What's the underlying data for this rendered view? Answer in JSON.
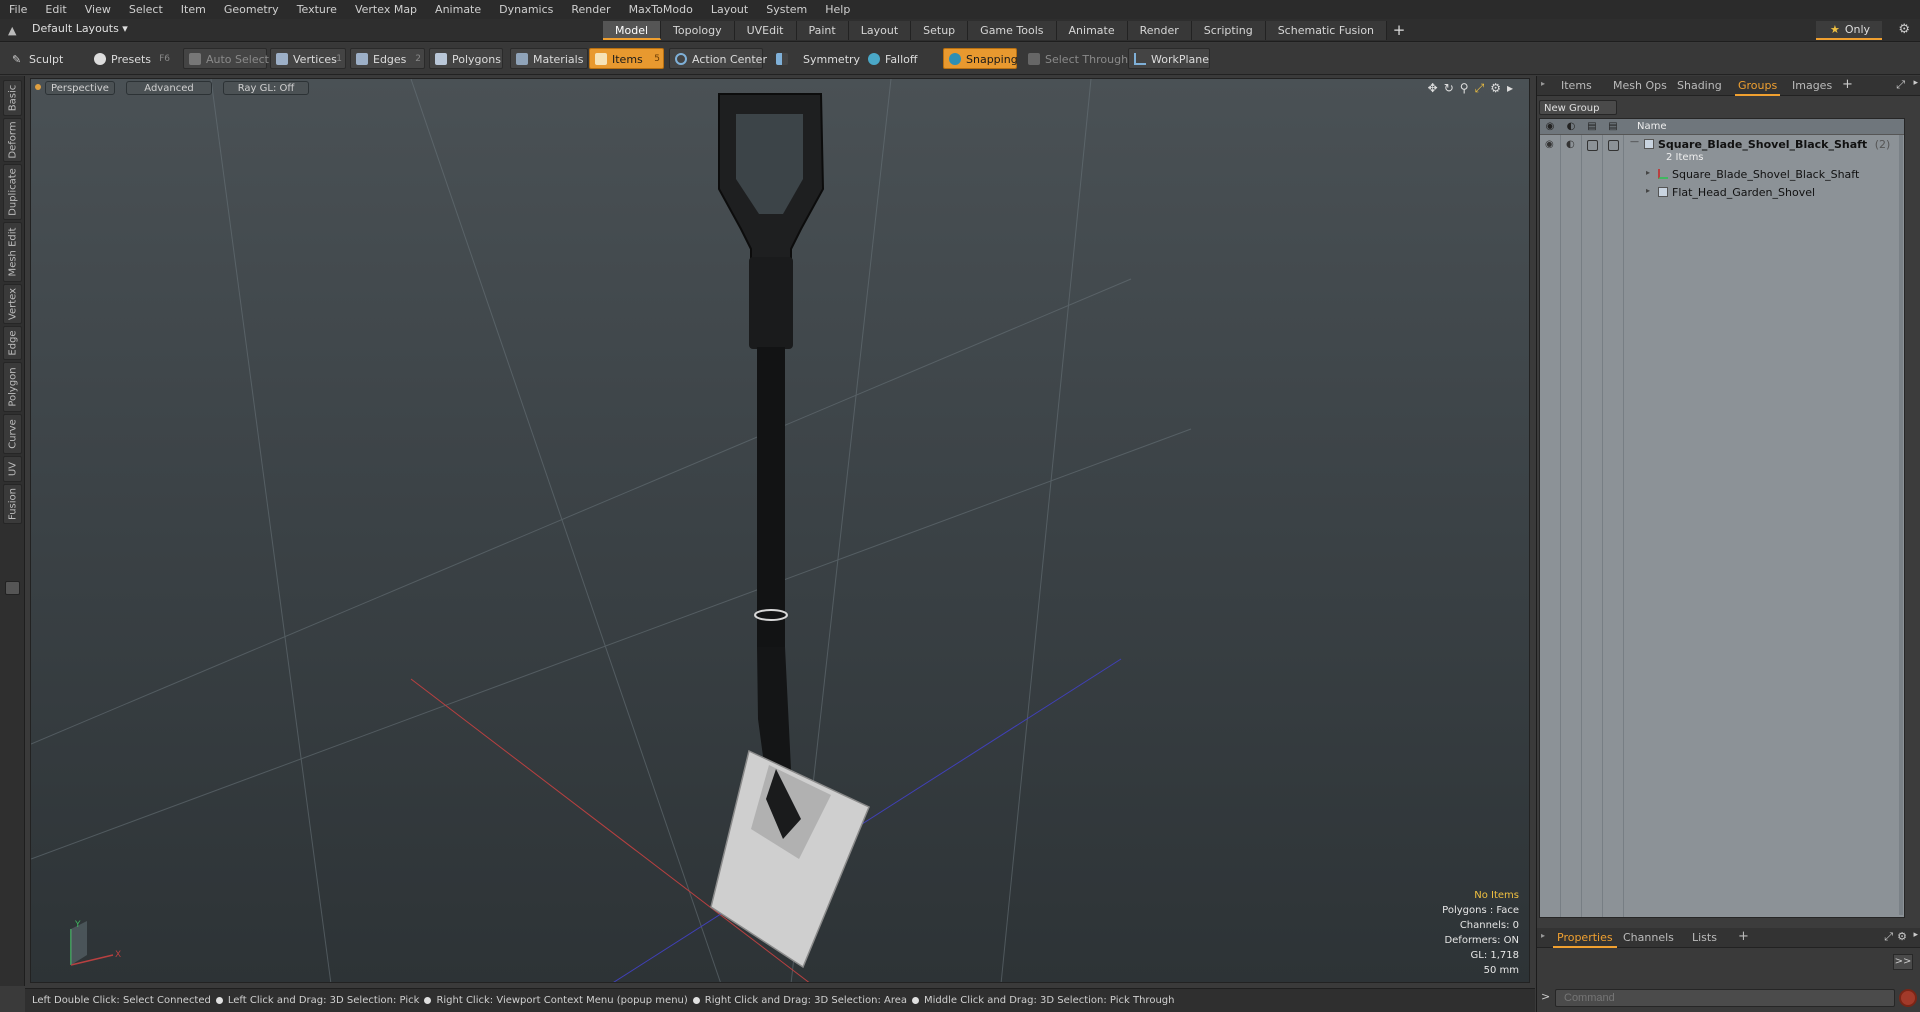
{
  "menu": [
    "File",
    "Edit",
    "View",
    "Select",
    "Item",
    "Geometry",
    "Texture",
    "Vertex Map",
    "Animate",
    "Dynamics",
    "Render",
    "MaxToModo",
    "Layout",
    "System",
    "Help"
  ],
  "layout": {
    "selector": "Default Layouts ▾",
    "tabs": [
      "Model",
      "Topology",
      "UVEdit",
      "Paint",
      "Layout",
      "Setup",
      "Game Tools",
      "Animate",
      "Render",
      "Scripting",
      "Schematic Fusion"
    ],
    "active_tab": "Model",
    "plus": "+",
    "only_label": "Only",
    "only_star": "★"
  },
  "toolbar": {
    "sculpt": "Sculpt",
    "presets": "Presets",
    "presets_key": "F6",
    "auto_select": "Auto Select",
    "vertices": "Vertices",
    "vertices_num": "1",
    "edges": "Edges",
    "edges_num": "2",
    "polygons": "Polygons",
    "materials": "Materials",
    "items": "Items",
    "items_num": "5",
    "action_center": "Action Center",
    "symmetry": "Symmetry",
    "falloff": "Falloff",
    "snapping": "Snapping",
    "select_through": "Select Through",
    "workplane": "WorkPlane"
  },
  "left_tabs": [
    "Basic",
    "Deform",
    "Duplicate",
    "Mesh Edit",
    "Vertex",
    "Edge",
    "Polygon",
    "Curve",
    "UV",
    "Fusion"
  ],
  "viewport": {
    "view": "Perspective",
    "shading": "Advanced",
    "raygl": "Ray GL: Off",
    "info": {
      "selection": "No Items",
      "polygons": "Polygons : Face",
      "channels": "Channels: 0",
      "deformers": "Deformers: ON",
      "gl": "GL: 1,718",
      "focal": "50 mm"
    },
    "axis_labels": {
      "x": "X",
      "y": "Y"
    }
  },
  "status": [
    "Left Double Click: Select Connected",
    "Left Click and Drag: 3D Selection: Pick",
    "Right Click: Viewport Context Menu (popup menu)",
    "Right Click and Drag: 3D Selection: Area",
    "Middle Click and Drag: 3D Selection: Pick Through"
  ],
  "right_panel": {
    "tabs": [
      "Items",
      "Mesh Ops",
      "Shading",
      "Groups",
      "Images"
    ],
    "active_tab": "Groups",
    "plus": "+",
    "new_group": "New Group",
    "name_header": "Name",
    "group": {
      "name": "Square_Blade_Shovel_Black_Shaft",
      "count": "(2)",
      "sub": "2 Items",
      "children": [
        "Square_Blade_Shovel_Black_Shaft",
        "Flat_Head_Garden_Shovel"
      ]
    },
    "bottom_tabs": [
      "Properties",
      "Channels",
      "Lists"
    ],
    "bottom_active": "Properties",
    "arrow": ">>",
    "command_placeholder": "Command"
  },
  "colors": {
    "accent": "#e8992f",
    "x_axis": "#b84040",
    "z_axis": "#4040b8",
    "y_axis": "#40b860"
  }
}
